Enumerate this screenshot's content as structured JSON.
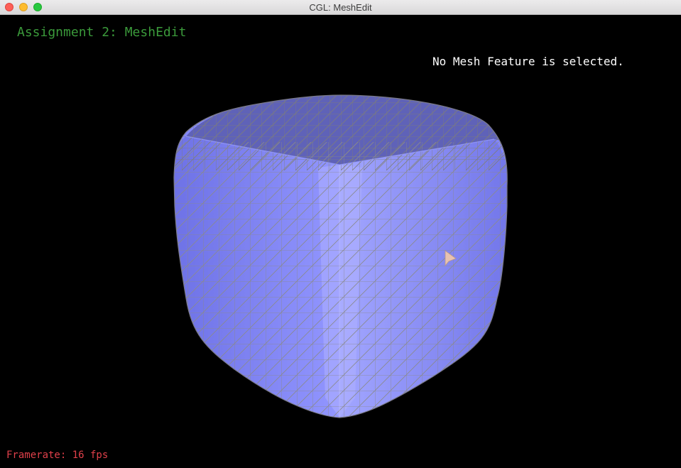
{
  "window": {
    "title": "CGL: MeshEdit"
  },
  "overlay": {
    "heading": "Assignment 2: MeshEdit",
    "selection_status": "No Mesh Feature is selected.",
    "framerate": "Framerate: 16 fps"
  },
  "colors": {
    "heading": "#3b9a3b",
    "status": "#ffffff",
    "framerate": "#e0404a",
    "mesh_fill": "#8f93ff",
    "wireframe": "#8a8a8a"
  },
  "icons": {
    "close": "window-close-icon",
    "minimize": "window-minimize-icon",
    "maximize": "window-zoom-icon",
    "cursor": "mouse-pointer-icon"
  }
}
